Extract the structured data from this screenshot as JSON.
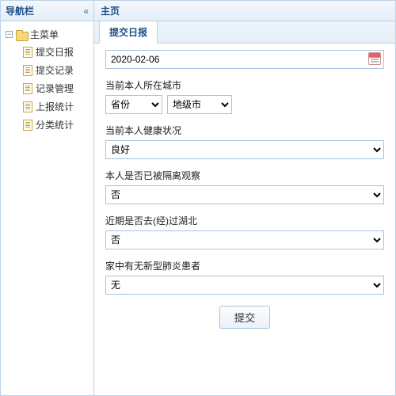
{
  "sidebar": {
    "title": "导航栏",
    "root": "主菜单",
    "items": [
      {
        "label": "提交日报"
      },
      {
        "label": "提交记录"
      },
      {
        "label": "记录管理"
      },
      {
        "label": "上报统计"
      },
      {
        "label": "分类统计"
      }
    ]
  },
  "main": {
    "title": "主页",
    "tab": "提交日报"
  },
  "form": {
    "date_value": "2020-02-06",
    "city_label": "当前本人所在城市",
    "province_selected": "省份",
    "city_selected": "地级市",
    "health_label": "当前本人健康状况",
    "health_selected": "良好",
    "quarantine_label": "本人是否已被隔离观察",
    "quarantine_selected": "否",
    "hubei_label": "近期是否去(经)过湖北",
    "hubei_selected": "否",
    "household_label": "家中有无新型肺炎患者",
    "household_selected": "无",
    "submit_label": "提交"
  }
}
